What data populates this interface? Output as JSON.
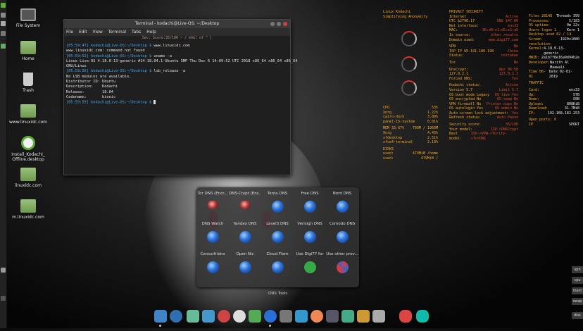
{
  "desktop": {
    "icons": [
      {
        "label": "File System"
      },
      {
        "label": "Home"
      },
      {
        "label": "Trash"
      },
      {
        "label": "www.linuxidc.com"
      },
      {
        "label": "Install_Kodachi_ Offline.desktop"
      },
      {
        "label": "linuxidc.com"
      },
      {
        "label": "m.linuxidc.com"
      }
    ]
  },
  "terminal": {
    "title": "Terminal - kodachi@Live-OS: ~/Desktop",
    "menu": [
      "File",
      "Edit",
      "View",
      "Terminal",
      "Tabs",
      "Help"
    ],
    "top_text": "Sec: Score:35/100 ~ /   ehk! of ^ ]",
    "lines": [
      {
        "prompt": "[05:59:47] kodachi@Live-OS:~/Desktop $",
        "cmd": " www.linuxidc.com"
      },
      {
        "prompt": "",
        "cmd": "www.linuxidc.com: command not found"
      },
      {
        "prompt": "[05:59:52] kodachi@Live-OS:~/Desktop $",
        "cmd": " uname -a"
      },
      {
        "prompt": "",
        "cmd": "Linux Live-OS 4.18.0-13-generic #14-18.04.1-Ubuntu SMP Thu Dec 6 14:09:52 UTC 2018 x86_64 x86_64 x86_64"
      },
      {
        "prompt": "",
        "cmd": "GNU/Linux"
      },
      {
        "prompt": "[05:59:56] kodachi@Live-OS:~/Desktop $",
        "cmd": " lsb_release -a"
      },
      {
        "prompt": "",
        "cmd": "No LSB modules are available."
      },
      {
        "prompt": "",
        "cmd": "Distributor ID: Ubuntu"
      },
      {
        "prompt": "",
        "cmd": "Description:    Kodachi"
      },
      {
        "prompt": "",
        "cmd": "Release:        18.04"
      },
      {
        "prompt": "",
        "cmd": "Codename:       bionic"
      },
      {
        "prompt": "[05:59:59] kodachi@Live-OS:~/Desktop $",
        "cmd": " "
      }
    ]
  },
  "conky_left": {
    "title": "Linux Kodachi",
    "subtitle": "Simplifying Anonymity"
  },
  "conky_cpu": {
    "rows": [
      [
        "CPU",
        "53%"
      ],
      [
        "Xorg",
        "1.22%"
      ],
      [
        "cairo-dock",
        "3.80%"
      ],
      [
        "panel-15-system",
        "0.81%"
      ],
      [
        "",
        ""
      ],
      [
        "MEM 33.67%",
        "709M / 1969M"
      ],
      [
        "Xorg",
        "4.43%"
      ],
      [
        "xfdesktop",
        "2.51%"
      ],
      [
        "xfce4-terminal",
        "2.19%"
      ],
      [
        "",
        ""
      ],
      [
        "DISKS",
        ""
      ],
      [
        "used:",
        "479MiB /home"
      ],
      [
        "used:",
        "479MiB /"
      ]
    ]
  },
  "conky_mid": {
    "rows": [
      [
        "PRIVACY SECURITY",
        ""
      ],
      [
        "Internet",
        "Active"
      ],
      [
        "UTC $2790.17",
        "UNS $47.80"
      ],
      [
        "Net interface:",
        "ens33"
      ],
      [
        "MAC:",
        "36:d9:c1:d5:e2:a5"
      ],
      [
        "Is source:",
        "other results"
      ],
      [
        "Domain used:",
        "www.digi77.com"
      ],
      [
        "",
        ""
      ],
      [
        "VPN",
        "No"
      ],
      [
        "ISP IP 60.191.180.190",
        "China"
      ],
      [
        "Status:",
        "nottaken"
      ],
      [
        "",
        ""
      ],
      [
        "Tor",
        "No"
      ],
      [
        "",
        ""
      ],
      [
        "DnsCrypt:",
        "Apr 06:58"
      ],
      [
        "127.0.2.1",
        "127.0.2.1"
      ],
      [
        "Forced DNS:",
        "Yes"
      ],
      [
        "",
        ""
      ],
      [
        "Kodachi status:",
        "Active"
      ],
      [
        "Version 5.7",
        "Limit 5.7"
      ],
      [
        "OS boot mode Legacy",
        "OS live Yes"
      ],
      [
        "OS encrypted No",
        "OS swap No"
      ],
      [
        "VPN firewall No",
        "Printer cups No"
      ],
      [
        "OS autologin Yes",
        "OS admin No"
      ],
      [
        "Auto screen lock adjustment:",
        "Yes"
      ],
      [
        "Refresh status:",
        "Auto Pause"
      ],
      [
        "",
        ""
      ],
      [
        "Security score:",
        "35/100"
      ],
      [
        "Your model:",
        "ISP->DNSCrypt"
      ],
      [
        "Best model:",
        "ISP->VPN->Torify->TorDNS"
      ]
    ]
  },
  "conky_right": {
    "rows": [
      [
        "Files 28148",
        "Threads 399"
      ],
      [
        "Processes:",
        "5/183"
      ],
      [
        "OS uptime:",
        "0m 22s"
      ],
      [
        "Users logon 1",
        "Kern 1"
      ],
      [
        "Desktop used 82 / 14",
        ""
      ],
      [
        "Screen resolution:",
        "1920x1080"
      ],
      [
        "Kernel:",
        "4.18.0-13-generic"
      ],
      [
        "HWID:",
        "2a1b7f8e16a9d94b2e"
      ],
      [
        "Developer:",
        "Warith Al Maawali"
      ],
      [
        "Time 06-01",
        "Date 02-01-2019"
      ],
      [
        "",
        ""
      ],
      [
        "TRAFFIC",
        ""
      ],
      [
        "",
        ""
      ],
      [
        "Card:",
        "ens33"
      ],
      [
        "Up:",
        "57B"
      ],
      [
        "Down:",
        "50B"
      ],
      [
        "Upload:",
        "808KiB"
      ],
      [
        "Download:",
        "31.7MiB"
      ],
      [
        "IP:",
        "192.168.182.253"
      ],
      [
        "",
        ""
      ],
      [
        "Open ports: 0",
        ""
      ],
      [
        "IP",
        "SPORT"
      ]
    ]
  },
  "dns_tools": {
    "label": "DNS Tools",
    "items": [
      {
        "label": "Tor DNS (Encr..."
      },
      {
        "label": "DNS-Crypt (Enc..."
      },
      {
        "label": "Tenta DNS"
      },
      {
        "label": "Free DNS"
      },
      {
        "label": "Nord DNS"
      },
      {
        "label": "DNS Watch"
      },
      {
        "label": "Yandex DNS"
      },
      {
        "label": "Level3 DNS"
      },
      {
        "label": "Verisign DNS"
      },
      {
        "label": "Comodo DNS"
      },
      {
        "label": "Censurfridns"
      },
      {
        "label": "Open Nic"
      },
      {
        "label": "Cloud Flare"
      },
      {
        "label": "Use Digi77 for"
      },
      {
        "label": "Use other prov..."
      }
    ]
  },
  "right_widgets": [
    "vpn",
    "cpu",
    "mem",
    "swap",
    "disk"
  ],
  "colors": {
    "accent_orange": "#f5a623",
    "accent_red": "#e24a2b",
    "prompt_blue": "#3fa9f5"
  }
}
